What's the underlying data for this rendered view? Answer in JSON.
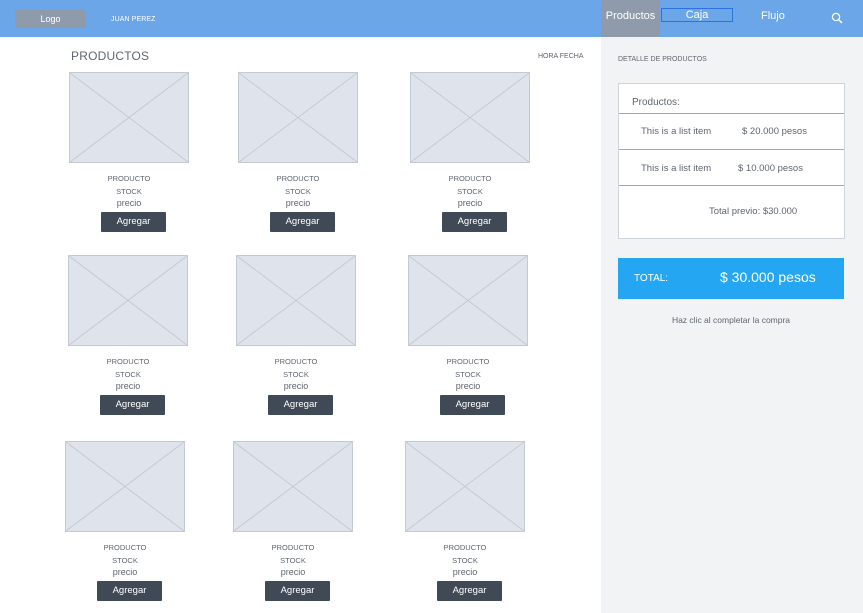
{
  "header": {
    "logo_label": "Logo",
    "user_name": "JUAN PEREZ",
    "tabs": [
      {
        "label": "Productos",
        "active": true
      },
      {
        "label": "Caja"
      },
      {
        "label": "Flujo"
      }
    ],
    "search_icon": "search-icon",
    "colors": {
      "bar": "#6aa6e8",
      "active_tab": "#8f9bab"
    }
  },
  "main": {
    "title": "PRODUCTOS",
    "datetime_label": "HORA FECHA",
    "products": [
      {
        "name": "PRODUCTO",
        "stock": "STOCK",
        "price": "precio",
        "button": "Agregar"
      },
      {
        "name": "PRODUCTO",
        "stock": "STOCK",
        "price": "precio",
        "button": "Agregar"
      },
      {
        "name": "PRODUCTO",
        "stock": "STOCK",
        "price": "precio",
        "button": "Agregar"
      },
      {
        "name": "PRODUCTO",
        "stock": "STOCK",
        "price": "precio",
        "button": "Agregar"
      },
      {
        "name": "PRODUCTO",
        "stock": "STOCK",
        "price": "precio",
        "button": "Agregar"
      },
      {
        "name": "PRODUCTO",
        "stock": "STOCK",
        "price": "precio",
        "button": "Agregar"
      },
      {
        "name": "PRODUCTO",
        "stock": "STOCK",
        "price": "precio",
        "button": "Agregar"
      },
      {
        "name": "PRODUCTO",
        "stock": "STOCK",
        "price": "precio",
        "button": "Agregar"
      },
      {
        "name": "PRODUCTO",
        "stock": "STOCK",
        "price": "precio",
        "button": "Agregar"
      }
    ]
  },
  "sidebar": {
    "detail_title": "DETALLE DE PRODUCTOS",
    "detail_heading": "Productos:",
    "items": [
      {
        "label": "This is a list item",
        "price": "$ 20.000 pesos"
      },
      {
        "label": "This is a list item",
        "price": "$ 10.000 pesos"
      }
    ],
    "subtotal": "Total previo: $30.000",
    "total_label": "TOTAL:",
    "total_value": "$ 30.000 pesos",
    "complete_text": "Haz clic al completar la compra",
    "colors": {
      "total_bar": "#24a6f2",
      "divider": "#a49af0"
    }
  }
}
